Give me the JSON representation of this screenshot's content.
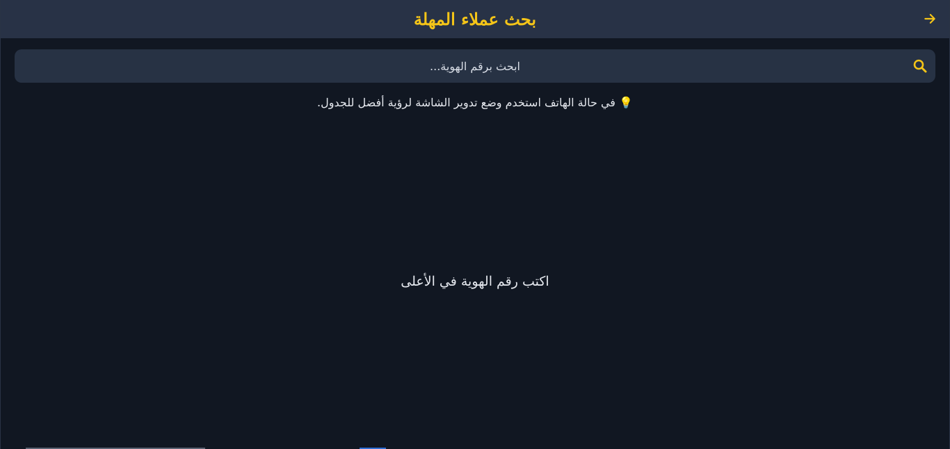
{
  "header": {
    "title": "بحث عملاء المهلة",
    "back_icon": "arrow-back-icon",
    "accent_color": "#f5c518"
  },
  "search": {
    "placeholder": "ابحث برقم الهوية...",
    "value": "",
    "icon": "search-icon"
  },
  "hint": {
    "text": "💡 في حالة الهاتف استخدم وضع تدوير الشاشة لرؤية أفضل للجدول."
  },
  "empty_state": {
    "text": "اكتب رقم الهوية في الأعلى"
  },
  "colors": {
    "background": "#111722",
    "header_bg": "#283246",
    "search_bg": "#273244",
    "icon_color": "#f5c518"
  }
}
